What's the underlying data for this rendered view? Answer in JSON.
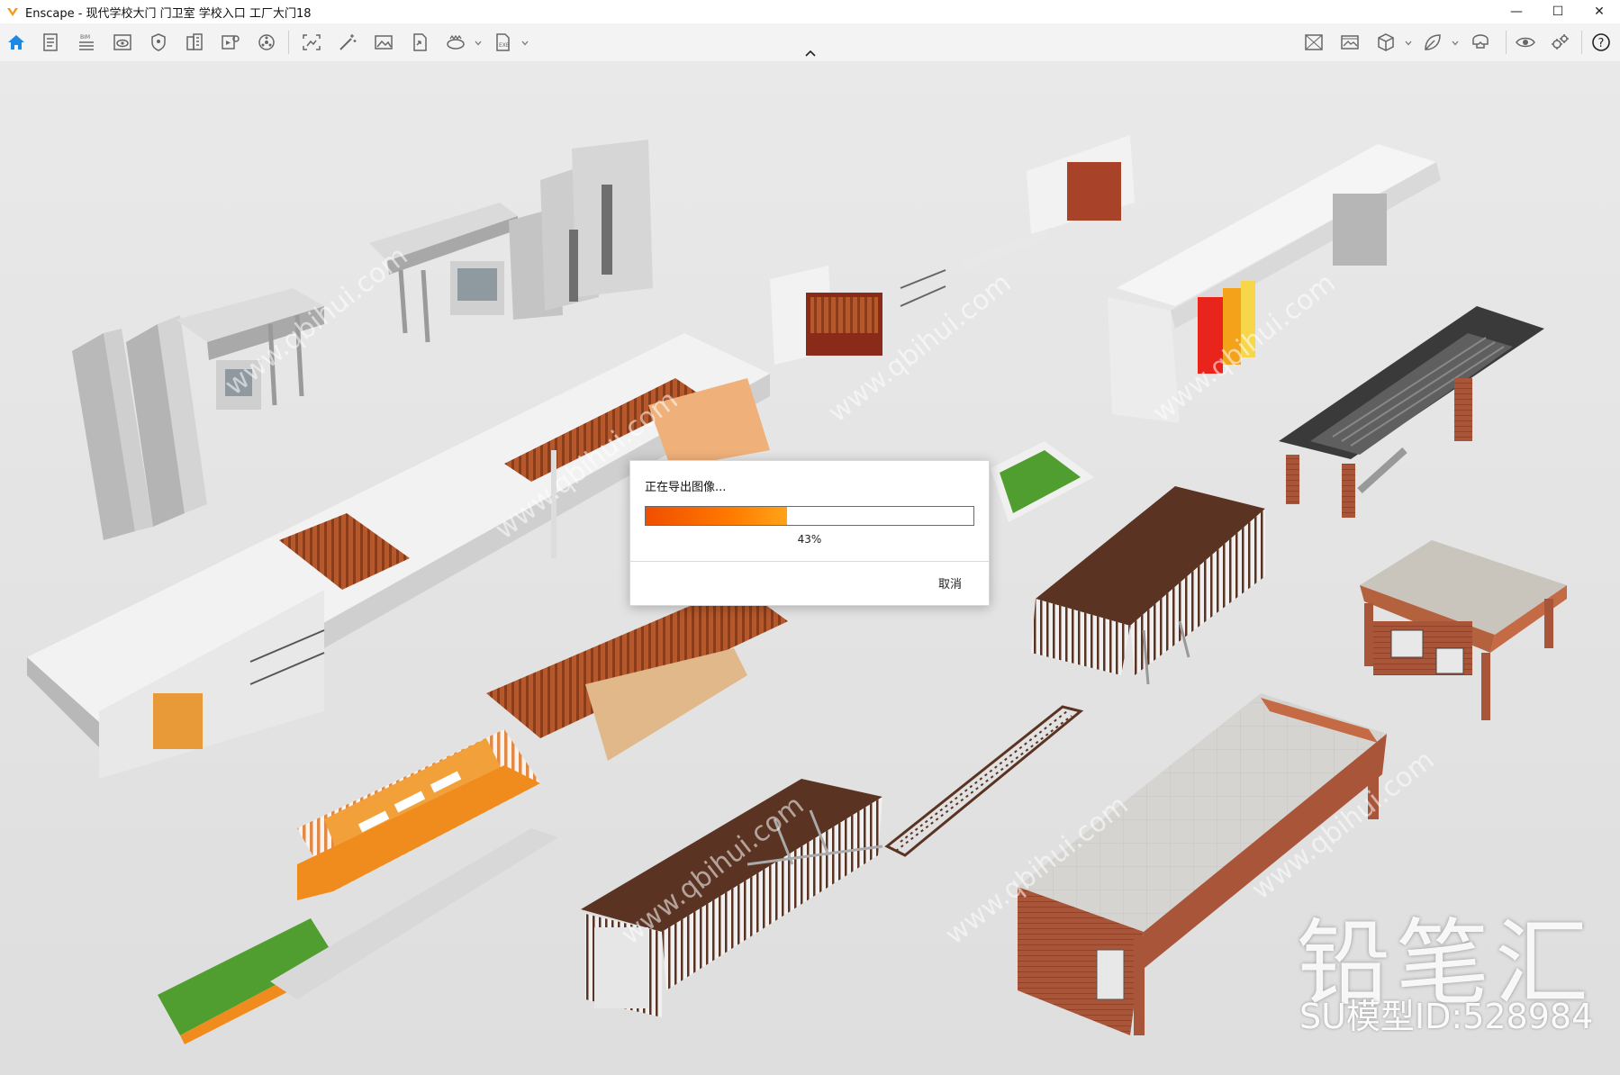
{
  "window": {
    "title": "Enscape - 现代学校大门 门卫室 学校入口 工厂大门18",
    "minimize": "—",
    "maximize": "☐",
    "close": "✕"
  },
  "toolbar": {
    "left_icons": [
      "home-icon",
      "document-icon",
      "bim-icon",
      "view-icon",
      "shield-icon",
      "building-icon",
      "video-icon",
      "atom-icon",
      "screenshot-icon",
      "magic-icon",
      "image-icon",
      "export-icon",
      "panorama-icon",
      "file-export-icon"
    ],
    "right_icons": [
      "settings-image-icon",
      "gallery-icon",
      "cube-icon",
      "leaf-icon",
      "vr-headset-icon",
      "eye-icon",
      "gear-icon",
      "help-icon"
    ],
    "help": "?"
  },
  "dialog": {
    "title": "正在导出图像...",
    "progress": 0.43,
    "percent_label": "43%",
    "cancel_label": "取消"
  },
  "watermark": {
    "brand": "铅笔汇",
    "model_id": "SU模型ID:528984"
  },
  "colors": {
    "accent": "#f07a1a",
    "brick": "#a9553a",
    "dark_brown": "#5a3322",
    "grass": "#4f9e2f"
  }
}
